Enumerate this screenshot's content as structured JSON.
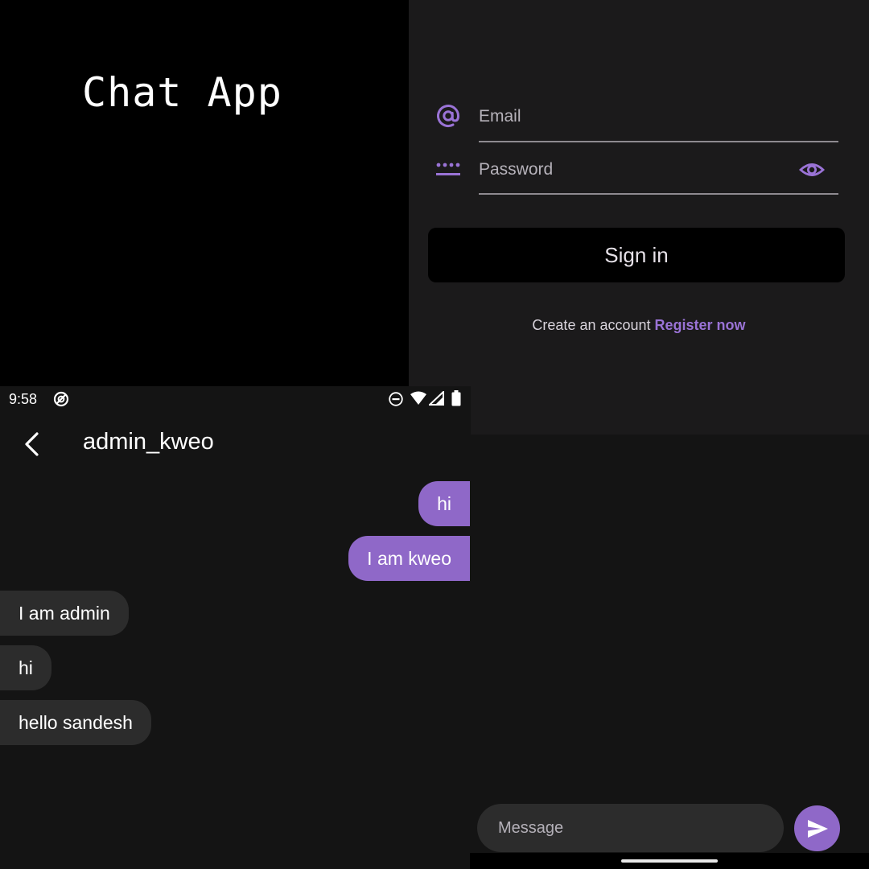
{
  "splash": {
    "title": "Chat App"
  },
  "login": {
    "email_placeholder": "Email",
    "password_placeholder": "Password",
    "email_icon": "at-icon",
    "password_icon": "password-dots-icon",
    "visibility_icon": "eye-icon",
    "signin_label": "Sign in",
    "register_prompt": "Create an account",
    "register_link": "Register now"
  },
  "status_bar": {
    "time": "9:58",
    "icons": [
      "notification-icon",
      "do-not-disturb-icon",
      "wifi-icon",
      "signal-icon",
      "battery-icon"
    ]
  },
  "chat": {
    "title": "admin_kweo",
    "back_icon": "chevron-left-icon",
    "messages": [
      {
        "text": "hi",
        "sender": "me"
      },
      {
        "text": "I am kweo",
        "sender": "me"
      },
      {
        "text": "I am admin",
        "sender": "other"
      },
      {
        "text": "hi",
        "sender": "other"
      },
      {
        "text": "hello sandesh",
        "sender": "other"
      }
    ],
    "input_placeholder": "Message",
    "send_icon": "send-icon"
  },
  "colors": {
    "accent": "#8f68c8",
    "link": "#9a73d6",
    "background": "#141414",
    "login_background": "#1b1a1b",
    "incoming_bubble": "#2c2c2c"
  }
}
